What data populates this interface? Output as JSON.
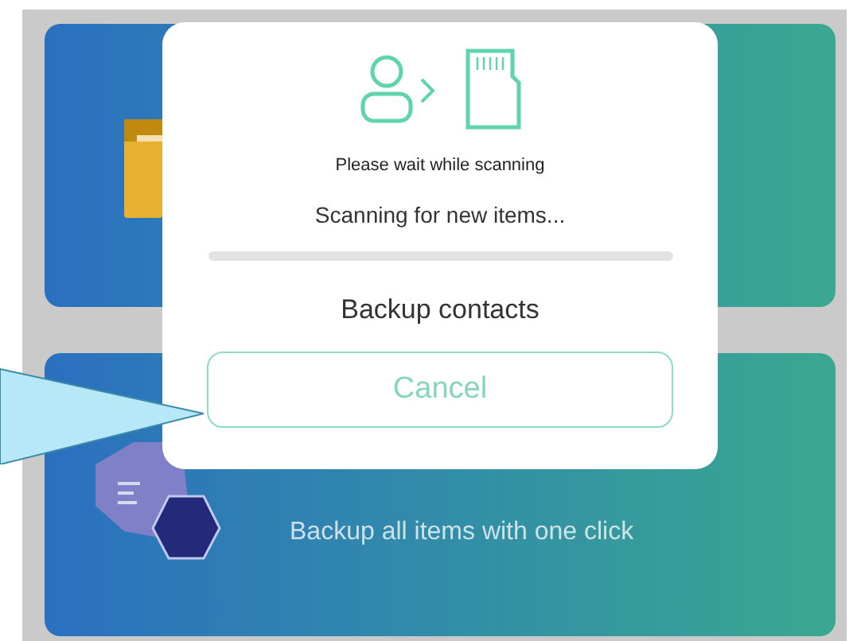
{
  "cards": [
    {
      "kind": "folder"
    },
    {
      "kind": "backup",
      "description": "Backup all items with one click"
    }
  ],
  "dialog": {
    "subtitle": "Please wait while scanning",
    "status": "Scanning for new items...",
    "progress": {
      "level": 0
    },
    "action": "Backup contacts",
    "cancel_button": "Cancel"
  }
}
